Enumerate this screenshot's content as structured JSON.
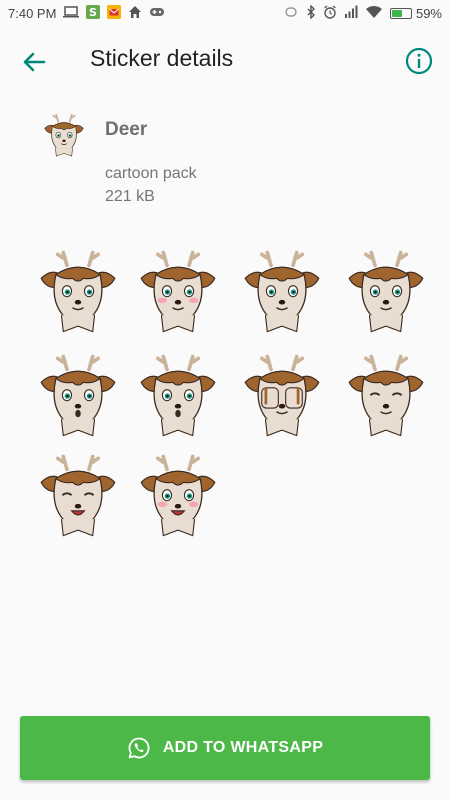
{
  "status_bar": {
    "time": "7:40 PM",
    "battery_percent": "59%",
    "battery_level": 0.59,
    "notification_icons": [
      "laptop-icon",
      "s-app-icon",
      "mail-app-icon",
      "home-icon",
      "gamepad-icon"
    ],
    "system_icons": [
      "vibrate-icon",
      "bluetooth-icon",
      "alarm-icon",
      "signal-icon",
      "wifi-icon",
      "battery-icon"
    ]
  },
  "toolbar": {
    "title": "Sticker details",
    "back_icon": "arrow-left-icon",
    "info_icon": "info-icon"
  },
  "pack": {
    "name": "Deer",
    "publisher": "cartoon pack",
    "size": "221 kB"
  },
  "stickers": [
    {
      "id": 1,
      "expression": "worried"
    },
    {
      "id": 2,
      "expression": "blushing"
    },
    {
      "id": 3,
      "expression": "smiling"
    },
    {
      "id": 4,
      "expression": "annoyed"
    },
    {
      "id": 5,
      "expression": "surprised"
    },
    {
      "id": 6,
      "expression": "shocked"
    },
    {
      "id": 7,
      "expression": "facepalm"
    },
    {
      "id": 8,
      "expression": "smug"
    },
    {
      "id": 9,
      "expression": "happy"
    },
    {
      "id": 10,
      "expression": "excited-blush"
    }
  ],
  "colors": {
    "accent": "#00897b",
    "button": "#4cb848",
    "fur": "#a0652f",
    "face": "#e9ddd2",
    "eye": "#1e9e8a"
  },
  "add_button": {
    "label": "ADD TO WHATSAPP",
    "icon": "whatsapp-icon"
  }
}
